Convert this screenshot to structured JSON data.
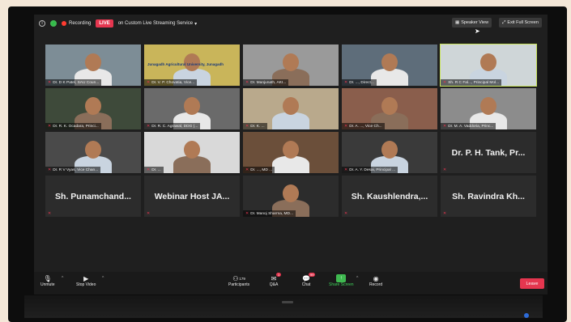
{
  "topbar": {
    "recording_label": "Recording",
    "live_label": "LIVE",
    "stream_label": "on Custom Live Streaming Service",
    "speaker_view_label": "Speaker View",
    "full_screen_label": "Exit Full Screen"
  },
  "tiles": [
    {
      "name": "Dr. D K Patel, SAU Coun...",
      "big": ""
    },
    {
      "name": "Dr. V. P. Chovatia, Vice...",
      "big": "",
      "banner": "Junagadh Agricultural University, Junagadh"
    },
    {
      "name": "Dr. Manjunath, AKI...",
      "big": ""
    },
    {
      "name": "Dr. ..., Direct...",
      "big": ""
    },
    {
      "name": "Sh. R C Fal..., Principal Mol...",
      "big": "",
      "active": true
    },
    {
      "name": "Dr. R. K. Ocadara, Princi...",
      "big": ""
    },
    {
      "name": "Dr. R. C. Agrawal, DDG (...",
      "big": ""
    },
    {
      "name": "Dr. K. ...",
      "big": ""
    },
    {
      "name": "Dr. A. ..., Vice Ch...",
      "big": ""
    },
    {
      "name": "Dr. M. A. Vaddoria, Princ...",
      "big": ""
    },
    {
      "name": "Dr. R V Vyas, Vice Chan...",
      "big": ""
    },
    {
      "name": "Dr. ...",
      "big": ""
    },
    {
      "name": "Dr. ..., MD ...",
      "big": ""
    },
    {
      "name": "Dr. A. Y. Desai, Principal ...",
      "big": ""
    },
    {
      "name": "",
      "big": "Dr. P. H. Tank, Pr..."
    },
    {
      "name": "",
      "big": "Sh. Punamchand..."
    },
    {
      "name": "",
      "big": "Webinar Host JA..."
    },
    {
      "name": "Dr. Manoj Sharma, MD...",
      "big": ""
    },
    {
      "name": "",
      "big": "Sh. Kaushlendra,..."
    },
    {
      "name": "",
      "big": "Sh. Ravindra Kh..."
    }
  ],
  "toolbar": {
    "unmute": "Unmute",
    "stop_video": "Stop Video",
    "participants": "Participants",
    "participants_count": "179",
    "qa": "Q&A",
    "qa_badge": "1",
    "chat": "Chat",
    "chat_badge": "99",
    "share_screen": "Share Screen",
    "record": "Record",
    "leave": "Leave"
  }
}
